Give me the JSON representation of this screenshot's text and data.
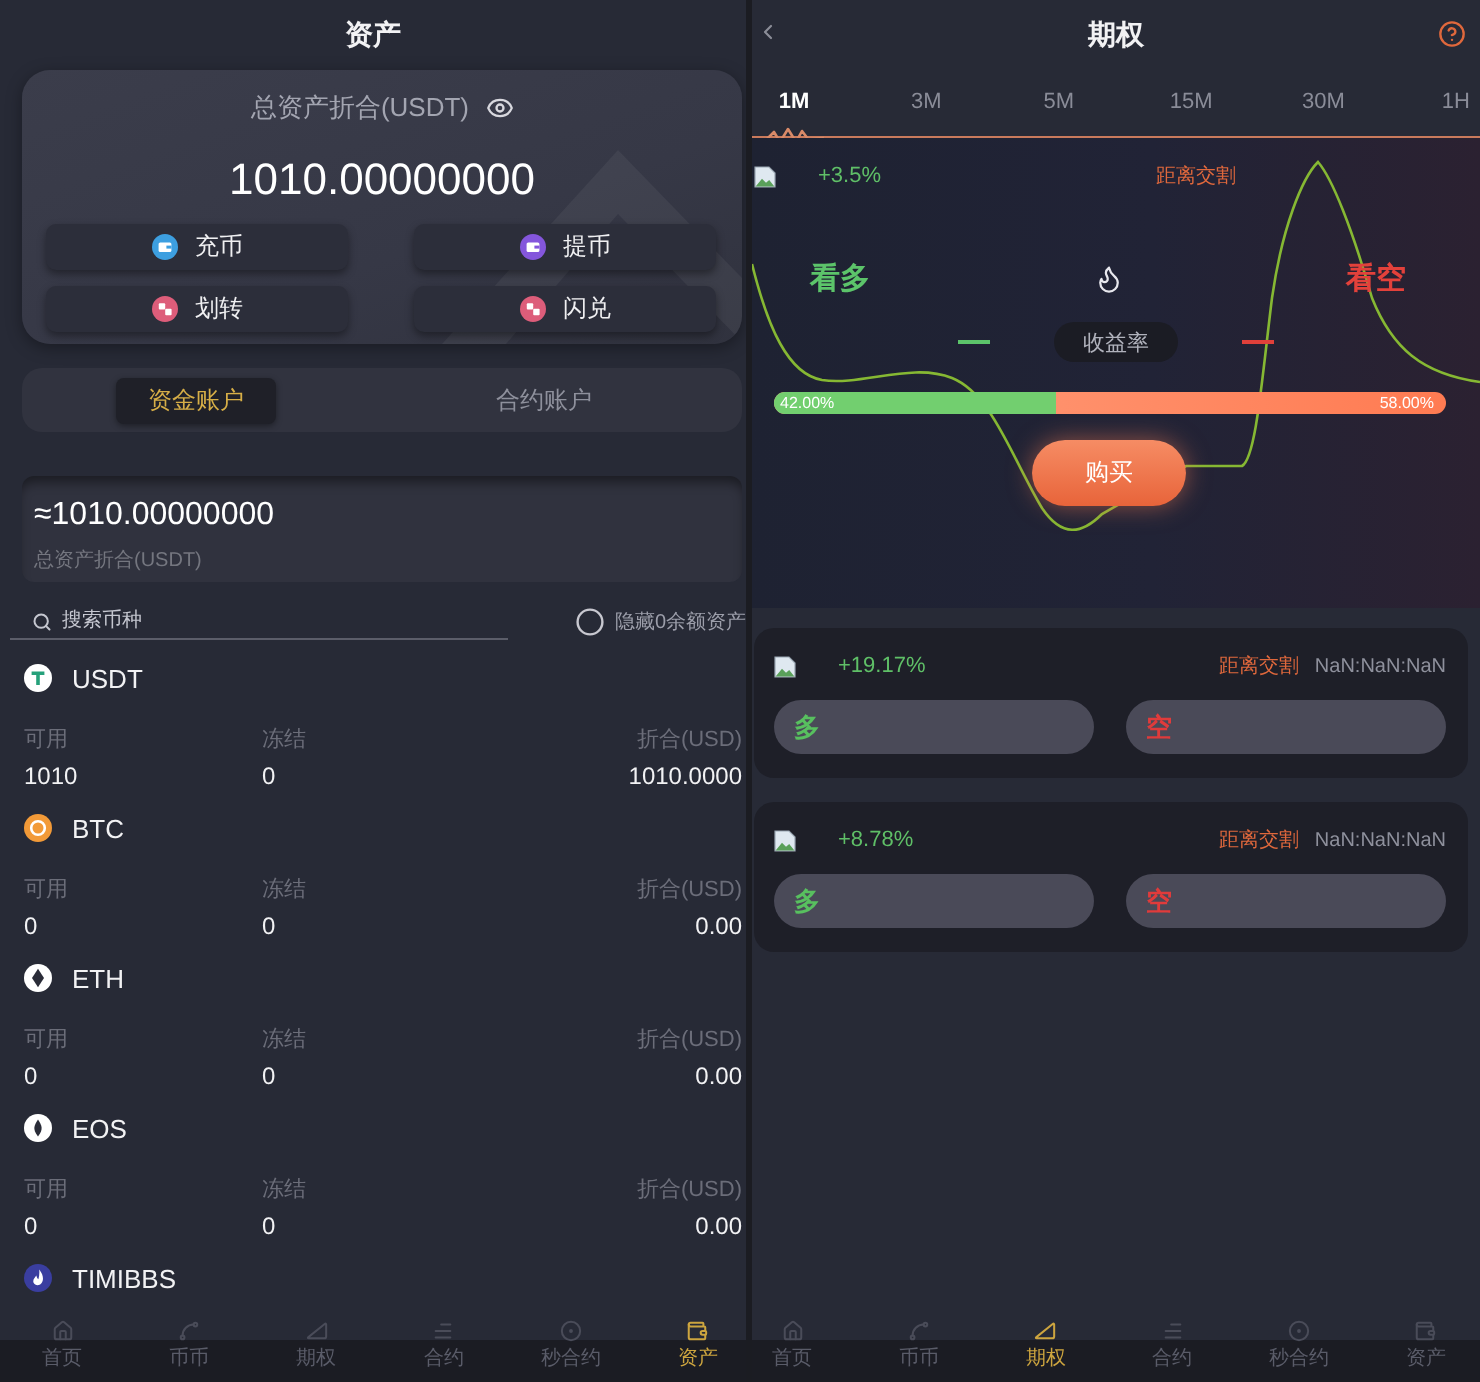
{
  "left_screen": {
    "title": "资产",
    "total_card": {
      "label": "总资产折合(USDT)",
      "value": "1010.00000000",
      "actions": [
        {
          "label": "充币",
          "color": "#3d9fe0"
        },
        {
          "label": "提币",
          "color": "#8456dc"
        },
        {
          "label": "划转",
          "color": "#dd5d7a"
        },
        {
          "label": "闪兑",
          "color": "#dd5d7a"
        }
      ]
    },
    "account_tabs": [
      {
        "label": "资金账户",
        "selected": true
      },
      {
        "label": "合约账户",
        "selected": false
      }
    ],
    "balance": {
      "value": "≈1010.00000000",
      "caption": "总资产折合(USDT)"
    },
    "search": {
      "placeholder": "搜索币种"
    },
    "hide_zero": {
      "label": "隐藏0余额资产",
      "checked": false
    },
    "coins": [
      {
        "name": "USDT",
        "columns": [
          {
            "label": "可用",
            "value": "1010"
          },
          {
            "label": "冻结",
            "value": "0"
          },
          {
            "label": "折合(USD)",
            "value": "1010.0000"
          }
        ]
      },
      {
        "name": "BTC",
        "columns": [
          {
            "label": "可用",
            "value": "0"
          },
          {
            "label": "冻结",
            "value": "0"
          },
          {
            "label": "折合(USD)",
            "value": "0.00"
          }
        ]
      },
      {
        "name": "ETH",
        "columns": [
          {
            "label": "可用",
            "value": "0"
          },
          {
            "label": "冻结",
            "value": "0"
          },
          {
            "label": "折合(USD)",
            "value": "0.00"
          }
        ]
      },
      {
        "name": "EOS",
        "columns": [
          {
            "label": "可用",
            "value": "0"
          },
          {
            "label": "冻结",
            "value": "0"
          },
          {
            "label": "折合(USD)",
            "value": "0.00"
          }
        ]
      },
      {
        "name": "TIMIBBS"
      }
    ],
    "nav": [
      {
        "label": "首页",
        "selected": false
      },
      {
        "label": "币币",
        "selected": false
      },
      {
        "label": "期权",
        "selected": false
      },
      {
        "label": "合约",
        "selected": false
      },
      {
        "label": "秒合约",
        "selected": false
      },
      {
        "label": "资产",
        "selected": true
      }
    ]
  },
  "right_screen": {
    "title": "期权",
    "periods": [
      {
        "label": "1M",
        "selected": true
      },
      {
        "label": "3M",
        "selected": false
      },
      {
        "label": "5M",
        "selected": false
      },
      {
        "label": "15M",
        "selected": false
      },
      {
        "label": "30M",
        "selected": false
      },
      {
        "label": "1H",
        "selected": false
      }
    ],
    "featured": {
      "change": "+3.5%",
      "countdown_label": "距离交割",
      "long_label": "看多",
      "short_label": "看空",
      "rate_label": "收益率",
      "long_share": "42.00%",
      "short_share": "58.00%",
      "level": 0.42,
      "buy_button": "购买"
    },
    "products": [
      {
        "change": "+19.17%",
        "countdown_label": "距离交割",
        "countdown": "NaN:NaN:NaN",
        "long_button": "多",
        "short_button": "空"
      },
      {
        "change": "+8.78%",
        "countdown_label": "距离交割",
        "countdown": "NaN:NaN:NaN",
        "long_button": "多",
        "short_button": "空"
      }
    ],
    "nav": [
      {
        "label": "首页",
        "selected": false
      },
      {
        "label": "币币",
        "selected": false
      },
      {
        "label": "期权",
        "selected": true
      },
      {
        "label": "合约",
        "selected": false
      },
      {
        "label": "秒合约",
        "selected": false
      },
      {
        "label": "资产",
        "selected": false
      }
    ]
  }
}
